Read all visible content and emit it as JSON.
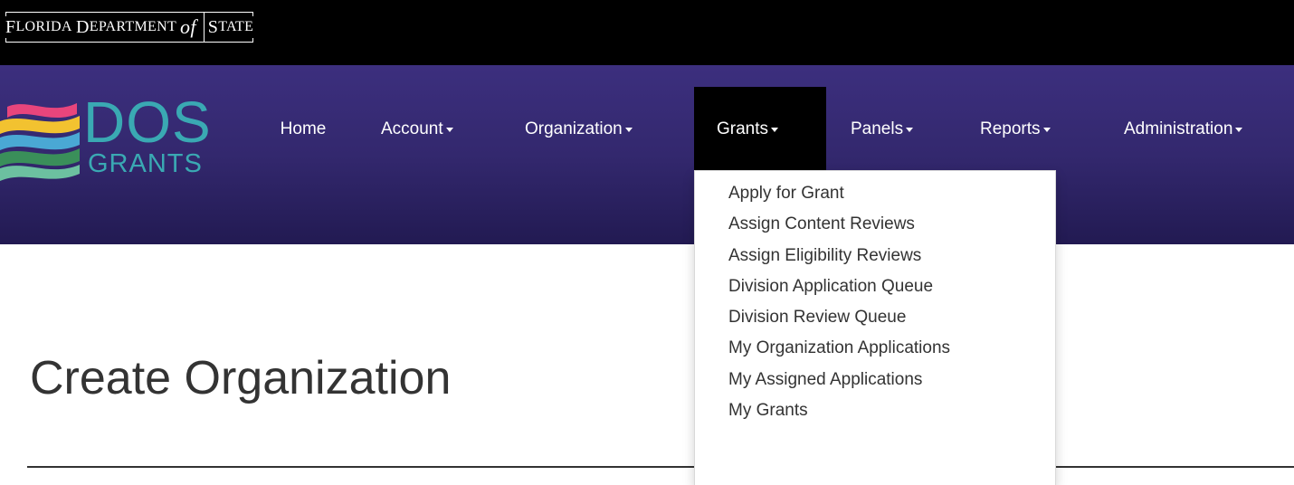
{
  "header": {
    "agency_logo": "Florida Department of State",
    "brand": {
      "line1": "DOS",
      "line2": "GRANTS",
      "color": "#3aa9b3"
    }
  },
  "nav": {
    "items": [
      {
        "label": "Home",
        "has_caret": false
      },
      {
        "label": "Account",
        "has_caret": true
      },
      {
        "label": "Organization",
        "has_caret": true
      },
      {
        "label": "Grants",
        "has_caret": true,
        "active": true
      },
      {
        "label": "Panels",
        "has_caret": true
      },
      {
        "label": "Reports",
        "has_caret": true
      },
      {
        "label": "Administration",
        "has_caret": true
      }
    ]
  },
  "grants_menu": {
    "items": [
      "Apply for Grant",
      "Assign Content Reviews",
      "Assign Eligibility Reviews",
      "Division Application Queue",
      "Division Review Queue",
      "My Organization Applications",
      "My Assigned Applications",
      "My Grants"
    ]
  },
  "page": {
    "title": "Create Organization"
  },
  "colors": {
    "topbar": "#000000",
    "navbar": "#33286e",
    "active_tab": "#000000",
    "text": "#333333"
  }
}
